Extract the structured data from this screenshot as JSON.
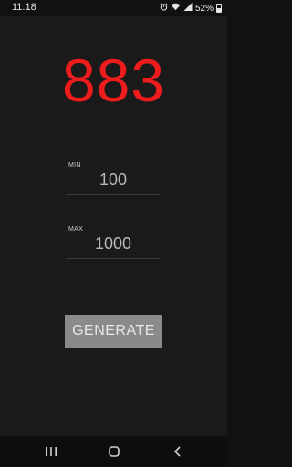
{
  "status_bar": {
    "time": "11:18",
    "battery": "52%",
    "icons": [
      "alarm-icon",
      "wifi-icon",
      "signal-icon",
      "battery-icon"
    ]
  },
  "result": {
    "value": "883",
    "color": "#ee1c1c"
  },
  "min_field": {
    "label": "MIN",
    "value": "100"
  },
  "max_field": {
    "label": "MAX",
    "value": "1000"
  },
  "generate_button": {
    "label": "GENERATE"
  },
  "nav_bar": {
    "buttons": [
      "recents-icon",
      "home-icon",
      "back-icon"
    ]
  }
}
